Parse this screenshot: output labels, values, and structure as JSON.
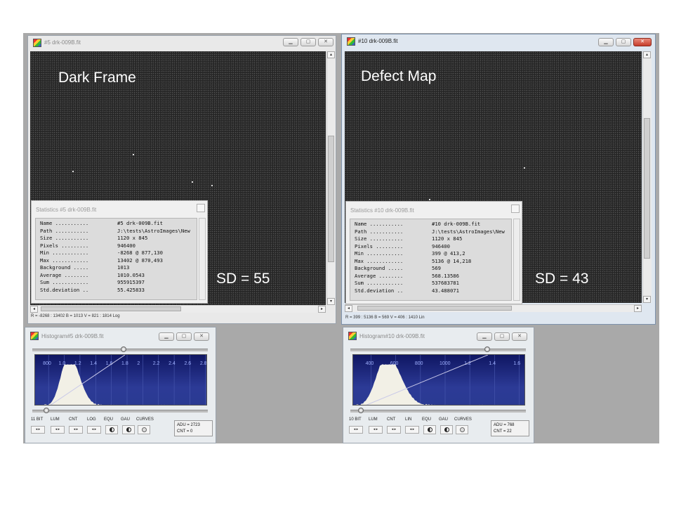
{
  "left_image_window": {
    "title": "#5 drk-009B.fit",
    "overlay_label": "Dark Frame",
    "sd_label": "SD = 55",
    "status": "R = -8268 : 13402   B = 1013   V = 821 : 1814 Log",
    "stats": {
      "title": "Statistics #5 drk-009B.fit",
      "rows": [
        {
          "k": "Name ...........",
          "v": "#5 drk-009B.fit"
        },
        {
          "k": "Path ...........",
          "v": "J:\\tests\\AstroImages\\New"
        },
        {
          "k": "Size ...........",
          "v": "1120 x 845"
        },
        {
          "k": "Pixels .........",
          "v": "946400"
        },
        {
          "k": "Min ............",
          "v": "-8268 @ 877,130"
        },
        {
          "k": "Max ............",
          "v": "13402 @ 870,493"
        },
        {
          "k": "Background .....",
          "v": "1013"
        },
        {
          "k": "Average ........",
          "v": "1010.0543"
        },
        {
          "k": "Sum ............",
          "v": "955915397"
        },
        {
          "k": "Std.deviation ..",
          "v": "55.425833"
        }
      ]
    }
  },
  "right_image_window": {
    "title": "#10 drk-009B.fit",
    "overlay_label": "Defect Map",
    "sd_label": "SD = 43",
    "status": "R = 399 : 5136   B = 569   V = 406 : 1410 Lin",
    "stats": {
      "title": "Statistics #10 drk-009B.fit",
      "rows": [
        {
          "k": "Name ...........",
          "v": "#10 drk-009B.fit"
        },
        {
          "k": "Path ...........",
          "v": "J:\\tests\\AstroImages\\New"
        },
        {
          "k": "Size ...........",
          "v": "1120 x 845"
        },
        {
          "k": "Pixels .........",
          "v": "946400"
        },
        {
          "k": "Min ............",
          "v": "399 @ 413,2"
        },
        {
          "k": "Max ............",
          "v": "5136 @ 14,218"
        },
        {
          "k": "Background .....",
          "v": "569"
        },
        {
          "k": "Average ........",
          "v": "568.13586"
        },
        {
          "k": "Sum ............",
          "v": "537683781"
        },
        {
          "k": "Std.deviation ..",
          "v": "43.488071"
        }
      ]
    }
  },
  "left_histogram": {
    "title": "Histogram#5 drk-009B.fit",
    "axis_labels": [
      "800",
      "1.0",
      "1.2",
      "1.4",
      "1.6",
      "1.8",
      "2",
      "2.2",
      "2.4",
      "2.6",
      "2.8"
    ],
    "controls": [
      "11 BIT",
      "LUM",
      "CNT",
      "LOG",
      "EQU",
      "GAU",
      "CURVES"
    ],
    "adu": "ADU = 2723",
    "cnt": "CNT = 0",
    "top_slider_level": 0.52,
    "bottom_slider_level": 0.08
  },
  "right_histogram": {
    "title": "Histogram#10 drk-009B.fit",
    "axis_labels": [
      "400",
      "600",
      "800",
      "1000",
      "1.2",
      "1.4",
      "1.6"
    ],
    "controls": [
      "10 BIT",
      "LUM",
      "CNT",
      "LIN",
      "EQU",
      "GAU",
      "CURVES"
    ],
    "adu": "ADU = 768",
    "cnt": "CNT = 22",
    "top_slider_level": 0.78,
    "bottom_slider_level": 0.06
  },
  "icons": {
    "minimize": "minimize-icon",
    "maximize": "maximize-icon",
    "close": "close-icon",
    "arrow_left": "◂",
    "arrow_right": "▸",
    "arrow_up": "▴",
    "arrow_down": "▾",
    "stepper": "◂ ▸",
    "win_min": "▁",
    "win_max": "▢",
    "win_close": "✕"
  },
  "colors": {
    "histogram_bg": "#1b2575",
    "histogram_fill": "#f2f0e6",
    "close_red": "#c63c2a"
  }
}
